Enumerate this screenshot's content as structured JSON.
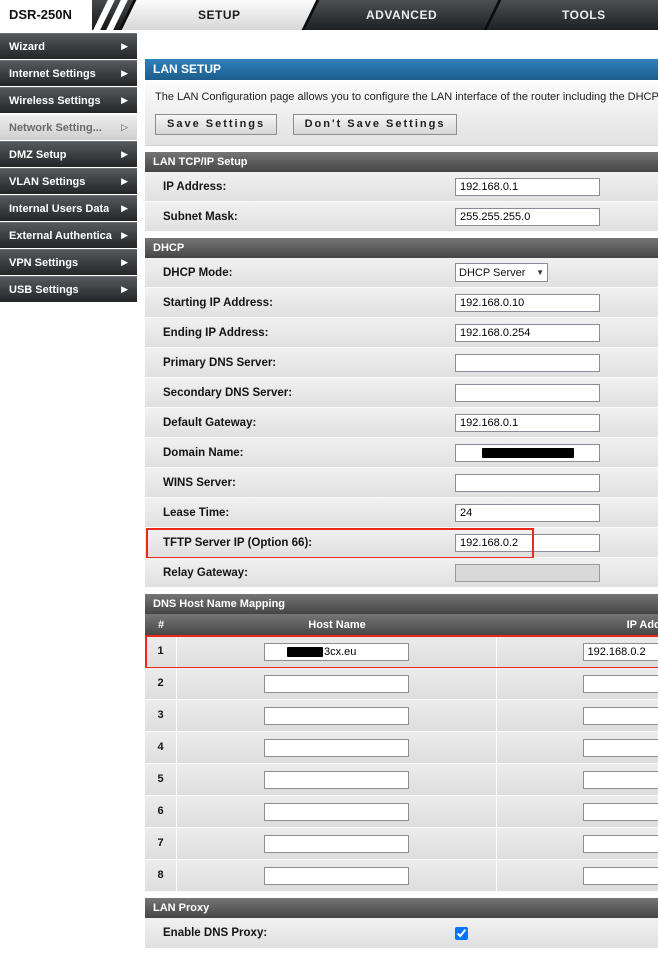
{
  "icons": {
    "arrow_right": "▶",
    "arrow_right_outline": "▷",
    "dropdown_arrow": "▼"
  },
  "colors": {
    "highlight_red": "#e8291c",
    "header_blue": "#2f81ba",
    "bar_dark_grey": "#555555"
  },
  "header": {
    "device": "DSR-250N",
    "tabs": [
      {
        "label": "SETUP",
        "active": true
      },
      {
        "label": "ADVANCED",
        "active": false
      },
      {
        "label": "TOOLS",
        "active": false
      }
    ]
  },
  "sidebar": {
    "items": [
      {
        "label": "Wizard",
        "active": false
      },
      {
        "label": "Internet Settings",
        "active": false
      },
      {
        "label": "Wireless Settings",
        "active": false
      },
      {
        "label": "Network Setting...",
        "active": true
      },
      {
        "label": "DMZ Setup",
        "active": false
      },
      {
        "label": "VLAN Settings",
        "active": false
      },
      {
        "label": "Internal Users Data",
        "active": false
      },
      {
        "label": "External Authentica",
        "active": false
      },
      {
        "label": "VPN Settings",
        "active": false
      },
      {
        "label": "USB Settings",
        "active": false
      }
    ]
  },
  "main": {
    "page_title": "LAN SETUP",
    "description": "The LAN Configuration page allows you to configure the LAN interface of the router including the DHCP",
    "buttons": {
      "save": "Save Settings",
      "dont_save": "Don't Save Settings"
    },
    "lan_tcpip": {
      "title": "LAN TCP/IP Setup",
      "fields": [
        {
          "label": "IP Address:",
          "value": "192.168.0.1"
        },
        {
          "label": "Subnet Mask:",
          "value": "255.255.255.0"
        }
      ]
    },
    "dhcp": {
      "title": "DHCP",
      "mode_label": "DHCP Mode:",
      "mode_value": "DHCP Server",
      "fields": [
        {
          "label": "Starting IP Address:",
          "value": "192.168.0.10"
        },
        {
          "label": "Ending IP Address:",
          "value": "192.168.0.254"
        },
        {
          "label": "Primary DNS Server:",
          "value": ""
        },
        {
          "label": "Secondary DNS Server:",
          "value": ""
        },
        {
          "label": "Default Gateway:",
          "value": "192.168.0.1"
        },
        {
          "label": "Domain Name:",
          "value": "",
          "redacted": true
        },
        {
          "label": "WINS Server:",
          "value": ""
        },
        {
          "label": "Lease Time:",
          "value": "24"
        },
        {
          "label": "TFTP Server IP (Option 66):",
          "value": "192.168.0.2",
          "highlighted": true
        },
        {
          "label": "Relay Gateway:",
          "value": "",
          "disabled": true
        }
      ]
    },
    "dns_mapping": {
      "title": "DNS Host Name Mapping",
      "columns": [
        "#",
        "Host Name",
        "IP Address"
      ],
      "rows": [
        {
          "num": "1",
          "host": "3cx.eu",
          "host_redacted_prefix": true,
          "ip": "192.168.0.2",
          "highlighted": true
        },
        {
          "num": "2",
          "host": "",
          "ip": ""
        },
        {
          "num": "3",
          "host": "",
          "ip": ""
        },
        {
          "num": "4",
          "host": "",
          "ip": ""
        },
        {
          "num": "5",
          "host": "",
          "ip": ""
        },
        {
          "num": "6",
          "host": "",
          "ip": ""
        },
        {
          "num": "7",
          "host": "",
          "ip": ""
        },
        {
          "num": "8",
          "host": "",
          "ip": ""
        }
      ]
    },
    "lan_proxy": {
      "title": "LAN Proxy",
      "enable_label": "Enable DNS Proxy:",
      "checked": "checked"
    }
  }
}
